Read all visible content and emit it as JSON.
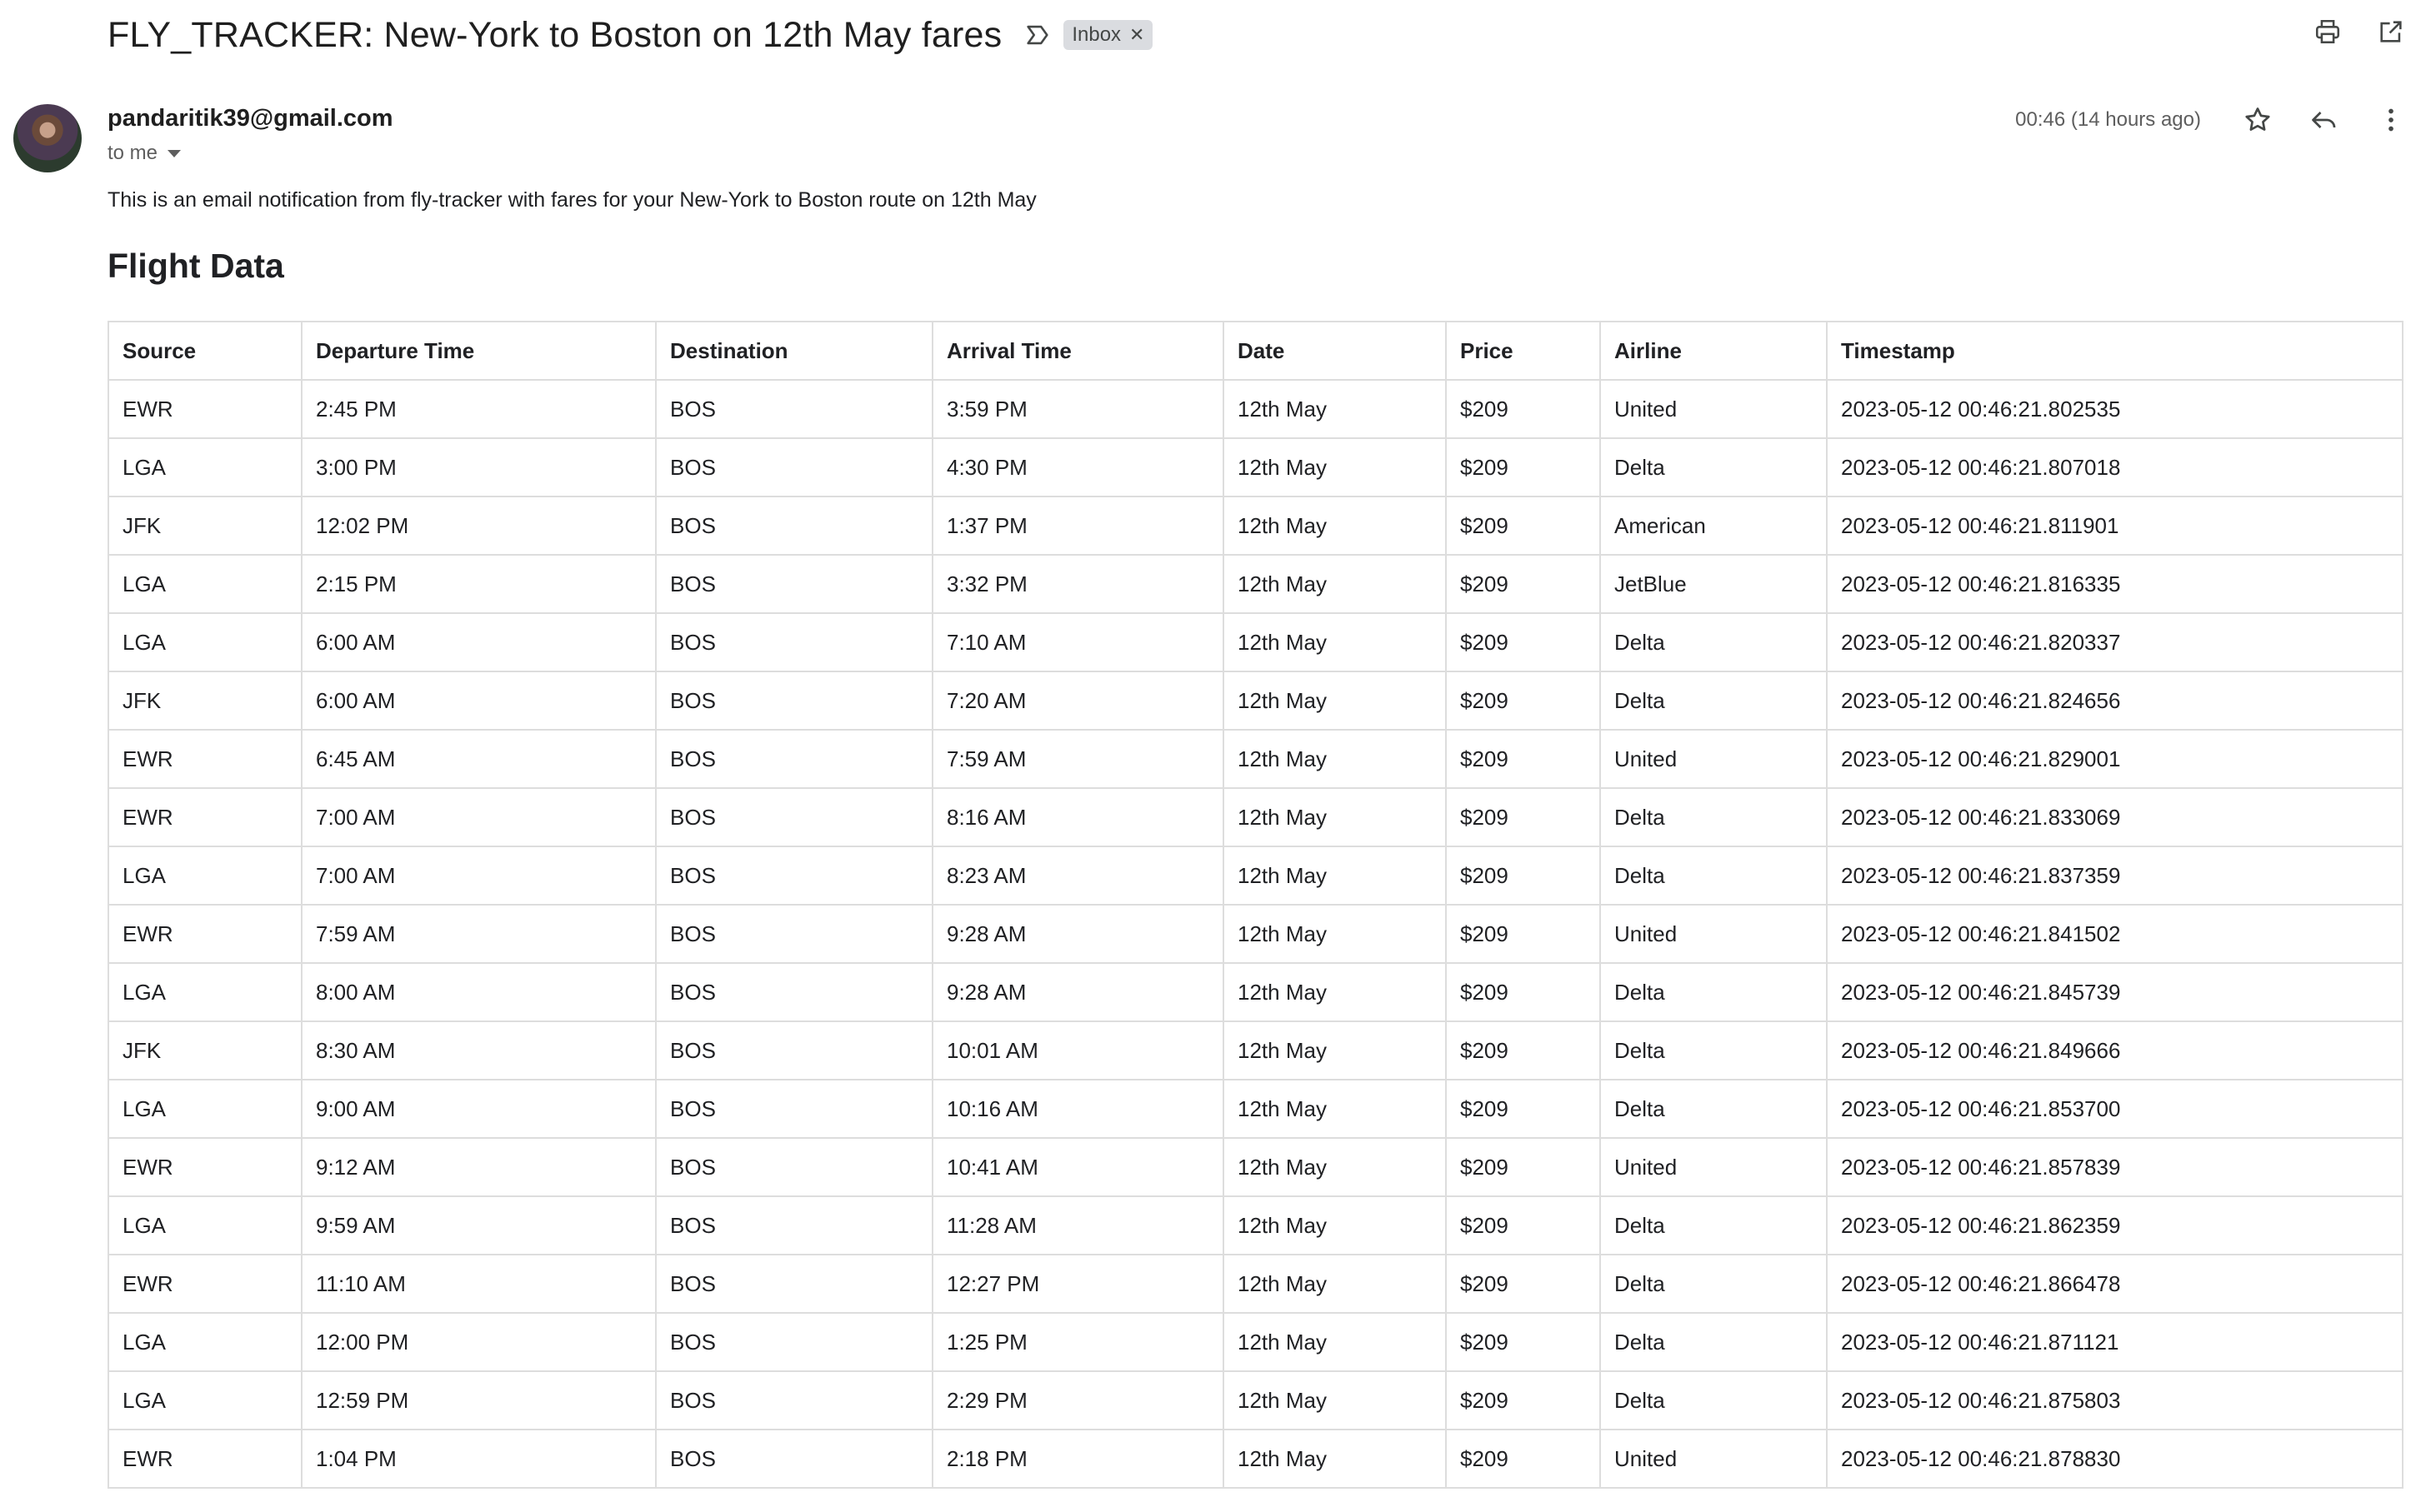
{
  "email": {
    "subject": "FLY_TRACKER: New-York to Boston on 12th May fares",
    "label": "Inbox",
    "sender": "pandaritik39@gmail.com",
    "recipient_text": "to me",
    "time": "00:46 (14 hours ago)",
    "body_text": "This is an email notification from fly-tracker with fares for your New-York to Boston route on 12th May",
    "section_heading": "Flight Data"
  },
  "icons": {
    "importance": "label-important-outline-icon",
    "chip_close": "close-icon",
    "print": "print-icon",
    "open_new_window": "open-in-new-icon",
    "star": "star-outline-icon",
    "reply": "reply-icon",
    "more": "more-vert-icon"
  },
  "table": {
    "headers": [
      "Source",
      "Departure Time",
      "Destination",
      "Arrival Time",
      "Date",
      "Price",
      "Airline",
      "Timestamp"
    ],
    "rows": [
      [
        "EWR",
        "2:45 PM",
        "BOS",
        "3:59 PM",
        "12th May",
        "$209",
        "United",
        "2023-05-12 00:46:21.802535"
      ],
      [
        "LGA",
        "3:00 PM",
        "BOS",
        "4:30 PM",
        "12th May",
        "$209",
        "Delta",
        "2023-05-12 00:46:21.807018"
      ],
      [
        "JFK",
        "12:02 PM",
        "BOS",
        "1:37 PM",
        "12th May",
        "$209",
        "American",
        "2023-05-12 00:46:21.811901"
      ],
      [
        "LGA",
        "2:15 PM",
        "BOS",
        "3:32 PM",
        "12th May",
        "$209",
        "JetBlue",
        "2023-05-12 00:46:21.816335"
      ],
      [
        "LGA",
        "6:00 AM",
        "BOS",
        "7:10 AM",
        "12th May",
        "$209",
        "Delta",
        "2023-05-12 00:46:21.820337"
      ],
      [
        "JFK",
        "6:00 AM",
        "BOS",
        "7:20 AM",
        "12th May",
        "$209",
        "Delta",
        "2023-05-12 00:46:21.824656"
      ],
      [
        "EWR",
        "6:45 AM",
        "BOS",
        "7:59 AM",
        "12th May",
        "$209",
        "United",
        "2023-05-12 00:46:21.829001"
      ],
      [
        "EWR",
        "7:00 AM",
        "BOS",
        "8:16 AM",
        "12th May",
        "$209",
        "Delta",
        "2023-05-12 00:46:21.833069"
      ],
      [
        "LGA",
        "7:00 AM",
        "BOS",
        "8:23 AM",
        "12th May",
        "$209",
        "Delta",
        "2023-05-12 00:46:21.837359"
      ],
      [
        "EWR",
        "7:59 AM",
        "BOS",
        "9:28 AM",
        "12th May",
        "$209",
        "United",
        "2023-05-12 00:46:21.841502"
      ],
      [
        "LGA",
        "8:00 AM",
        "BOS",
        "9:28 AM",
        "12th May",
        "$209",
        "Delta",
        "2023-05-12 00:46:21.845739"
      ],
      [
        "JFK",
        "8:30 AM",
        "BOS",
        "10:01 AM",
        "12th May",
        "$209",
        "Delta",
        "2023-05-12 00:46:21.849666"
      ],
      [
        "LGA",
        "9:00 AM",
        "BOS",
        "10:16 AM",
        "12th May",
        "$209",
        "Delta",
        "2023-05-12 00:46:21.853700"
      ],
      [
        "EWR",
        "9:12 AM",
        "BOS",
        "10:41 AM",
        "12th May",
        "$209",
        "United",
        "2023-05-12 00:46:21.857839"
      ],
      [
        "LGA",
        "9:59 AM",
        "BOS",
        "11:28 AM",
        "12th May",
        "$209",
        "Delta",
        "2023-05-12 00:46:21.862359"
      ],
      [
        "EWR",
        "11:10 AM",
        "BOS",
        "12:27 PM",
        "12th May",
        "$209",
        "Delta",
        "2023-05-12 00:46:21.866478"
      ],
      [
        "LGA",
        "12:00 PM",
        "BOS",
        "1:25 PM",
        "12th May",
        "$209",
        "Delta",
        "2023-05-12 00:46:21.871121"
      ],
      [
        "LGA",
        "12:59 PM",
        "BOS",
        "2:29 PM",
        "12th May",
        "$209",
        "Delta",
        "2023-05-12 00:46:21.875803"
      ],
      [
        "EWR",
        "1:04 PM",
        "BOS",
        "2:18 PM",
        "12th May",
        "$209",
        "United",
        "2023-05-12 00:46:21.878830"
      ]
    ]
  }
}
